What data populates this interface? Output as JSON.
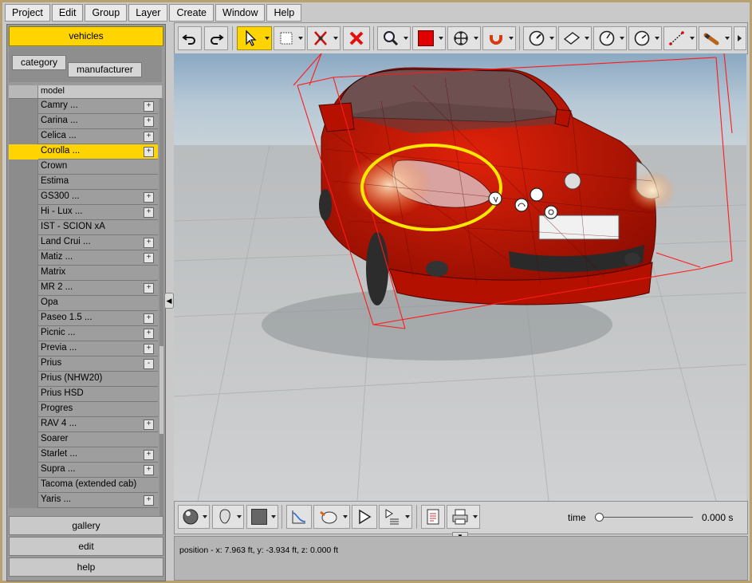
{
  "menu": [
    "Project",
    "Edit",
    "Group",
    "Layer",
    "Create",
    "Window",
    "Help"
  ],
  "left_panel": {
    "vehicles_label": "vehicles",
    "tabs": {
      "category": "category",
      "manufacturer": "manufacturer"
    },
    "column_header": "model",
    "rows": [
      {
        "label": "Camry ...",
        "expandable": "+"
      },
      {
        "label": "Carina ...",
        "expandable": "+"
      },
      {
        "label": "Celica ...",
        "expandable": "+"
      },
      {
        "label": "Corolla ...",
        "expandable": "+",
        "selected": true
      },
      {
        "label": "Crown",
        "expandable": ""
      },
      {
        "label": "Estima",
        "expandable": ""
      },
      {
        "label": "GS300 ...",
        "expandable": "+"
      },
      {
        "label": "Hi - Lux ...",
        "expandable": "+"
      },
      {
        "label": "IST - SCION xA",
        "expandable": ""
      },
      {
        "label": "Land Crui ...",
        "expandable": "+"
      },
      {
        "label": "Matiz ...",
        "expandable": "+"
      },
      {
        "label": "Matrix",
        "expandable": ""
      },
      {
        "label": "MR 2 ...",
        "expandable": "+"
      },
      {
        "label": "Opa",
        "expandable": ""
      },
      {
        "label": "Paseo 1.5 ...",
        "expandable": "+"
      },
      {
        "label": "Picnic ...",
        "expandable": "+"
      },
      {
        "label": "Previa ...",
        "expandable": "+"
      },
      {
        "label": "Prius",
        "expandable": "-"
      },
      {
        "label": "Prius (NHW20)",
        "expandable": ""
      },
      {
        "label": "Prius HSD",
        "expandable": ""
      },
      {
        "label": "Progres",
        "expandable": ""
      },
      {
        "label": "RAV 4 ...",
        "expandable": "+"
      },
      {
        "label": "Soarer",
        "expandable": ""
      },
      {
        "label": "Starlet ...",
        "expandable": "+"
      },
      {
        "label": "Supra ...",
        "expandable": "+"
      },
      {
        "label": "Tacoma (extended cab)",
        "expandable": ""
      },
      {
        "label": "Yaris ...",
        "expandable": "+"
      }
    ],
    "bottom_buttons": {
      "gallery": "gallery",
      "edit": "edit",
      "help": "help"
    }
  },
  "toolbar_icons": [
    "undo-icon",
    "redo-icon",
    "select-arrow-icon",
    "select-rectangle-icon",
    "cut-icon",
    "delete-icon",
    "zoom-icon",
    "color-swatch-icon",
    "move-icon",
    "magnet-icon",
    "angle-icon",
    "plane-icon",
    "angle-measure-icon",
    "angle-measure-2-icon",
    "distance-icon",
    "light-icon"
  ],
  "colors": {
    "accent": "#ffd400",
    "viewport_sky": "#9bb6cc",
    "car": "#cc1200",
    "bbox": "#ff1a1a",
    "highlight_ring": "#ffe800"
  },
  "timeline": {
    "label": "time",
    "value": "0.000 s",
    "position": 0.0
  },
  "status": {
    "text": "position - x: 7.963 ft, y: -3.934 ft, z: 0.000 ft"
  }
}
